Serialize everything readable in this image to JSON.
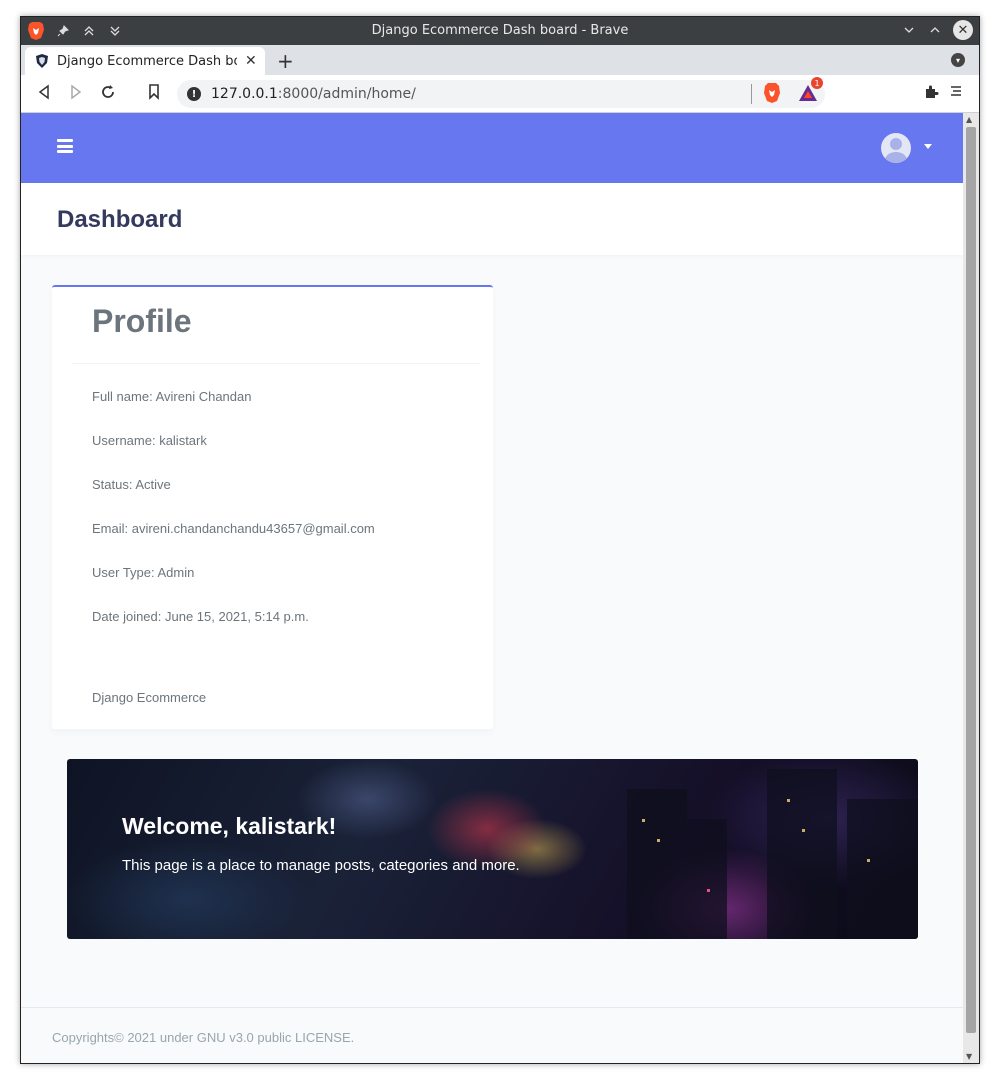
{
  "window": {
    "title": "Django Ecommerce Dash board - Brave"
  },
  "tab": {
    "title": "Django Ecommerce Dash board",
    "close": "✕",
    "new_tab": "+"
  },
  "url": {
    "host": "127.0.0.1",
    "path": ":8000/admin/home/"
  },
  "brave": {
    "rewards_badge": "1"
  },
  "page_header": {
    "title": "Dashboard"
  },
  "profile": {
    "title": "Profile",
    "full_name": "Full name: Avireni Chandan",
    "username": "Username: kalistark",
    "status": "Status: Active",
    "email": "Email: avireni.chandanchandu43657@gmail.com",
    "user_type": "User Type: Admin",
    "date_joined": "Date joined: June 15, 2021, 5:14 p.m.",
    "footer": "Django Ecommerce"
  },
  "hero": {
    "heading": "Welcome, kalistark!",
    "text": "This page is a place to manage posts, categories and more."
  },
  "footer": {
    "text": "Copyrights© 2021 under GNU v3.0 public LICENSE."
  },
  "colors": {
    "navbar": "#6777ef",
    "heading": "#34395e",
    "muted": "#6c757d"
  },
  "icons": [
    "brave-lion-icon",
    "pin-icon",
    "keep-above-icon",
    "keep-below-icon",
    "minimize-icon",
    "maximize-icon",
    "close-window-icon",
    "shield-favicon-icon",
    "back-icon",
    "forward-icon",
    "reload-icon",
    "bookmark-icon",
    "site-info-icon",
    "brave-shield-icon",
    "brave-rewards-icon",
    "extensions-icon",
    "menu-icon",
    "hamburger-icon",
    "user-avatar-icon",
    "caret-down-icon"
  ]
}
